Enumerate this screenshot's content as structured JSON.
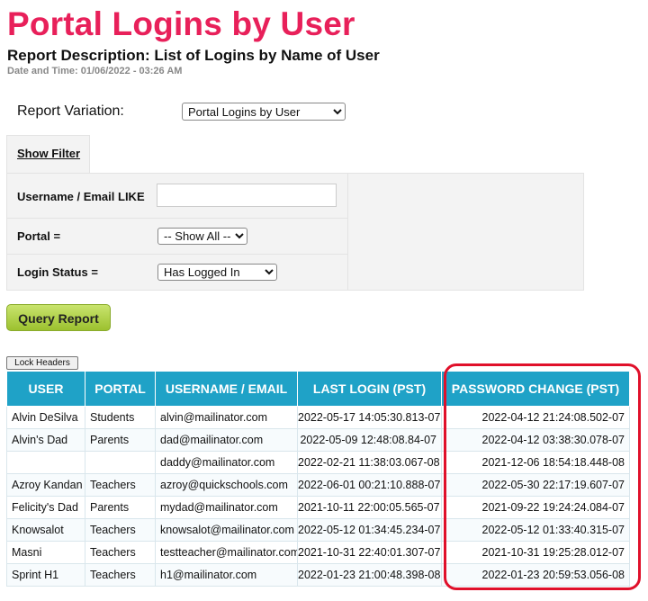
{
  "header": {
    "title": "Portal Logins by User",
    "description": "Report Description: List of Logins by Name of User",
    "datetime": "Date and Time: 01/06/2022 - 03:26 AM"
  },
  "variation": {
    "label": "Report Variation:",
    "selected": "Portal Logins by User"
  },
  "filter": {
    "tab_label": "Show Filter",
    "username_label": "Username / Email LIKE",
    "username_value": "",
    "portal_label": "Portal =",
    "portal_selected": "-- Show All --",
    "status_label": "Login Status =",
    "status_selected": "Has Logged In"
  },
  "buttons": {
    "query": "Query Report",
    "lock_headers": "Lock Headers"
  },
  "table": {
    "headers": [
      "USER",
      "PORTAL",
      "USERNAME / EMAIL",
      "LAST LOGIN (PST)",
      "PASSWORD CHANGE (PST)"
    ],
    "rows": [
      [
        "Alvin DeSilva",
        "Students",
        "alvin@mailinator.com",
        "2022-05-17 14:05:30.813-07",
        "2022-04-12 21:24:08.502-07"
      ],
      [
        "Alvin's Dad",
        "Parents",
        "dad@mailinator.com",
        "2022-05-09 12:48:08.84-07",
        "2022-04-12 03:38:30.078-07"
      ],
      [
        "",
        "",
        "daddy@mailinator.com",
        "2022-02-21 11:38:03.067-08",
        "2021-12-06 18:54:18.448-08"
      ],
      [
        "Azroy Kandan",
        "Teachers",
        "azroy@quickschools.com",
        "2022-06-01 00:21:10.888-07",
        "2022-05-30 22:17:19.607-07"
      ],
      [
        "Felicity's Dad",
        "Parents",
        "mydad@mailinator.com",
        "2021-10-11 22:00:05.565-07",
        "2021-09-22 19:24:24.084-07"
      ],
      [
        "Knowsalot",
        "Teachers",
        "knowsalot@mailinator.com",
        "2022-05-12 01:34:45.234-07",
        "2022-05-12 01:33:40.315-07"
      ],
      [
        "Masni",
        "Teachers",
        "testteacher@mailinator.com",
        "2021-10-31 22:40:01.307-07",
        "2021-10-31 19:25:28.012-07"
      ],
      [
        "Sprint H1",
        "Teachers",
        "h1@mailinator.com",
        "2022-01-23 21:00:48.398-08",
        "2022-01-23 20:59:53.056-08"
      ]
    ]
  },
  "colors": {
    "title": "#e8205a",
    "header_bg": "#1fa2c7",
    "highlight": "#e0102a",
    "button": "#b2d24a"
  }
}
